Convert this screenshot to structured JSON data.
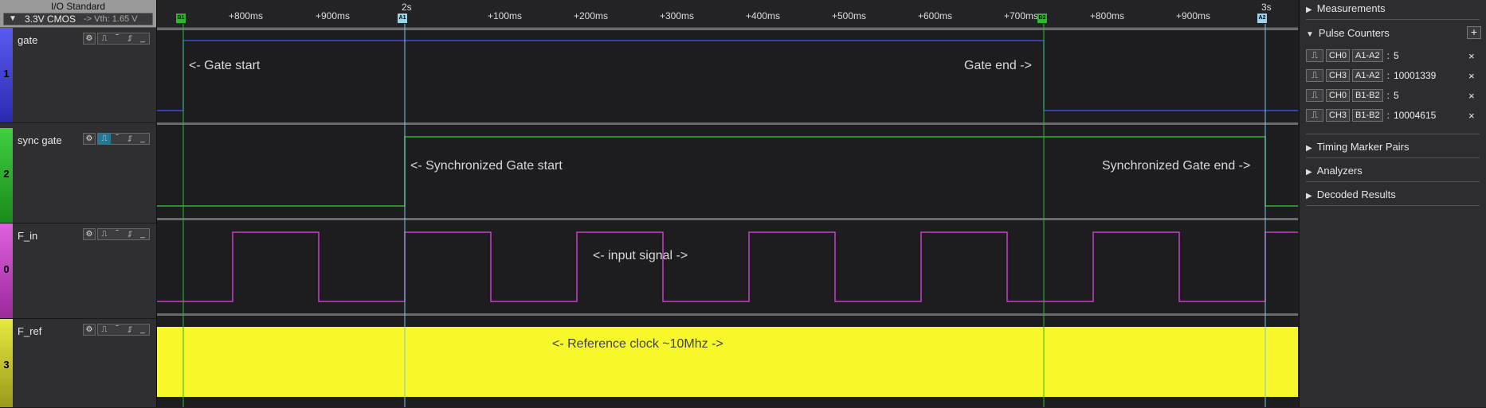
{
  "io": {
    "title": "I/O Standard",
    "value": "3.3V CMOS",
    "vth": "-> Vth: 1.65 V"
  },
  "channels": [
    {
      "name": "gate",
      "index": "1",
      "color": "#3b4fd8"
    },
    {
      "name": "sync gate",
      "index": "2",
      "color": "#2fb52f"
    },
    {
      "name": "F_in",
      "index": "0",
      "color": "#c93ec9"
    },
    {
      "name": "F_ref",
      "index": "3",
      "color": "#c8c82a"
    }
  ],
  "ruler": {
    "ticks": [
      "+800ms",
      "+900ms",
      "+100ms",
      "+200ms",
      "+300ms",
      "+400ms",
      "+500ms",
      "+600ms",
      "+700ms",
      "+800ms",
      "+900ms"
    ],
    "major": [
      "2s",
      "3s"
    ],
    "markers": [
      "B1",
      "A1",
      "B2",
      "A2"
    ]
  },
  "annotations": {
    "gate_start": "<- Gate start",
    "gate_end": "Gate end ->",
    "sync_start": "<- Synchronized Gate start",
    "sync_end": "Synchronized Gate end ->",
    "input": "<- input signal ->",
    "ref": "<- Reference clock ~10Mhz ->"
  },
  "panel": {
    "measurements": "Measurements",
    "pulse_counters": "Pulse Counters",
    "add": "+",
    "counters": [
      {
        "ch": "CH0",
        "range": "A1-A2",
        "value": "5"
      },
      {
        "ch": "CH3",
        "range": "A1-A2",
        "value": "10001339"
      },
      {
        "ch": "CH0",
        "range": "B1-B2",
        "value": "5"
      },
      {
        "ch": "CH3",
        "range": "B1-B2",
        "value": "10004615"
      }
    ],
    "timing": "Timing Marker Pairs",
    "analyzers": "Analyzers",
    "decoded": "Decoded Results",
    "close": "×",
    "colon": ":"
  },
  "colors": {
    "gate": "#3b4fd8",
    "sync": "#2fb52f",
    "fin": "#c93ec9",
    "ref": "#f7f72a",
    "markerB": "#2fb52f",
    "markerA": "#7fc4e0"
  }
}
